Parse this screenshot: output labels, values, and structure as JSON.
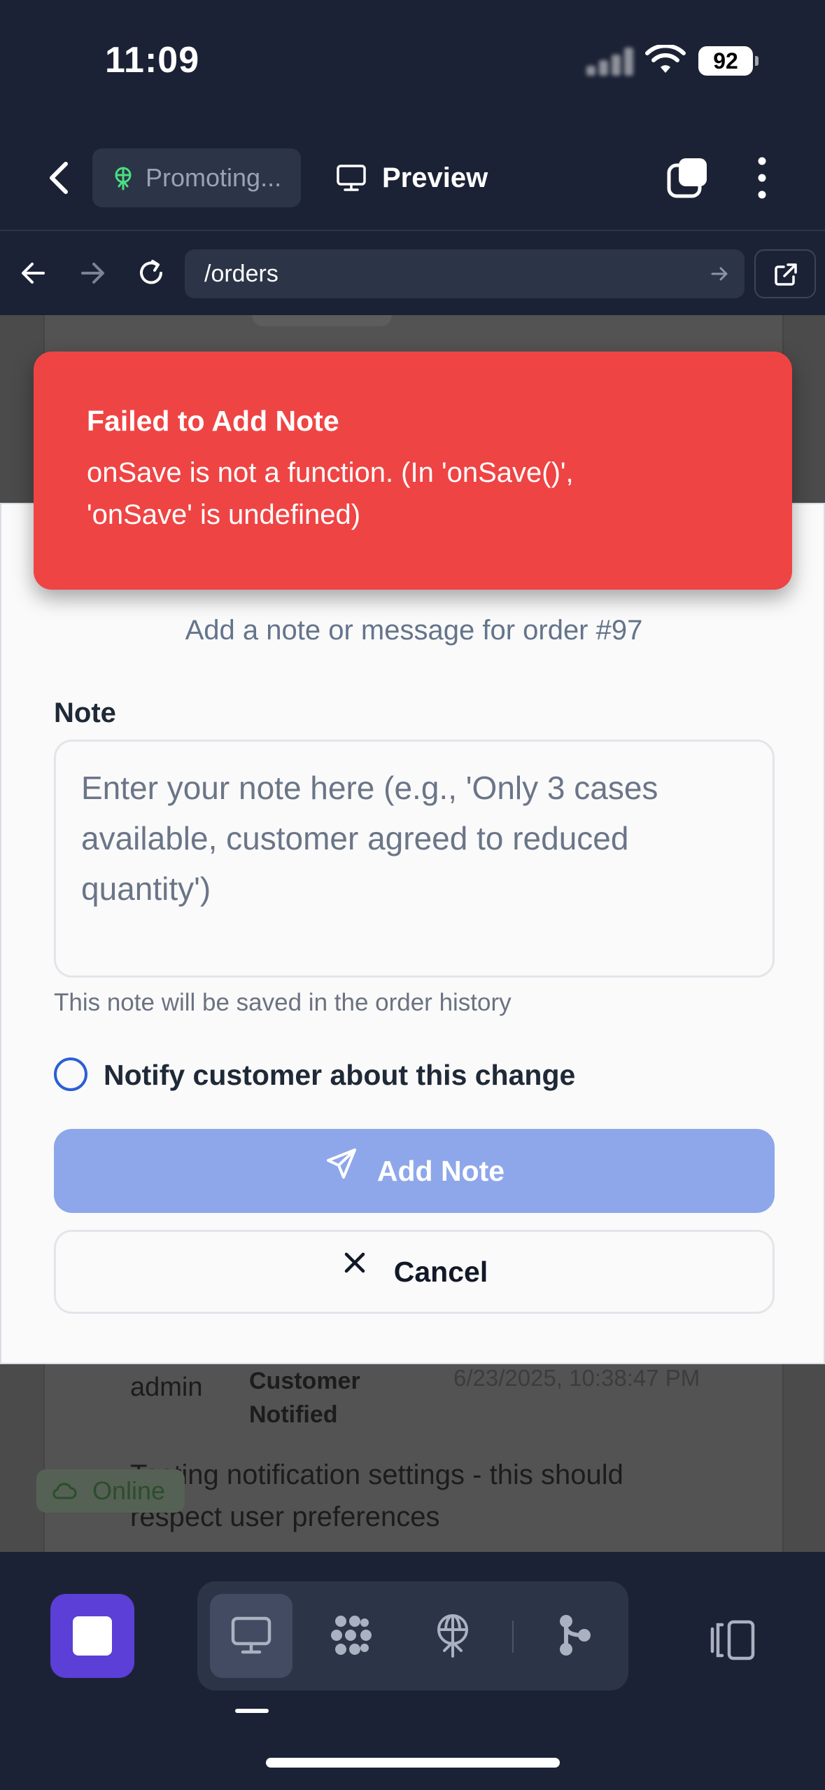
{
  "status_bar": {
    "time": "11:09",
    "battery": "92"
  },
  "header": {
    "chip_label": "Promoting...",
    "preview_label": "Preview"
  },
  "browser": {
    "url": "/orders"
  },
  "background": {
    "history_user": "admin",
    "history_status": "Customer Notified",
    "history_date": "6/23/2025, 10:38:47 PM",
    "history_note": "Testing notification settings - this should respect user preferences",
    "online_badge": "Online"
  },
  "toast": {
    "title": "Failed to Add Note",
    "message": "onSave is not a function. (In 'onSave()', 'onSave' is undefined)"
  },
  "modal": {
    "subtitle": "Add a note or message for order #97",
    "note_label": "Note",
    "note_placeholder": "Enter your note here (e.g., 'Only 3 cases available, customer agreed to reduced quantity')",
    "note_value": "",
    "helper_text": "This note will be saved in the order history",
    "notify_label": "Notify customer about this change",
    "notify_checked": false,
    "add_button": "Add Note",
    "cancel_button": "Cancel"
  },
  "dock": {
    "tabs": [
      "monitor-icon",
      "dots-grid-icon",
      "globe-network-icon",
      "branch-icon"
    ],
    "active_tab": "monitor-icon"
  },
  "colors": {
    "chrome_bg": "#1c2235",
    "toast_red": "#ef4444",
    "primary_button": "#8ea7ea",
    "stop_button": "#5b3fd6",
    "radio_blue": "#2c5fd4"
  }
}
